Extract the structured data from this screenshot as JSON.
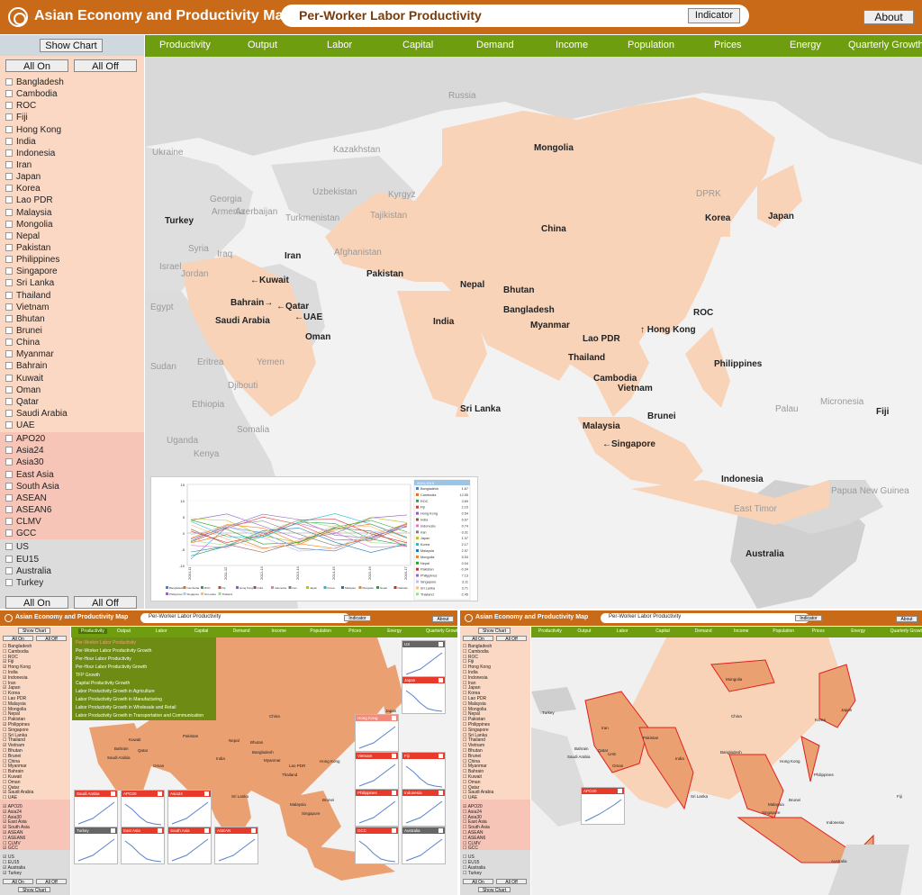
{
  "app": {
    "title": "Asian Economy and Productivity Map",
    "indicator_value": "Per-Worker Labor Productivity",
    "indicator_button": "Indicator",
    "about_button": "About"
  },
  "nav": [
    "Productivity",
    "Output",
    "Labor",
    "Capital",
    "Demand",
    "Income",
    "Population",
    "Prices",
    "Energy",
    "Quarterly Growth"
  ],
  "sidebar": {
    "show_chart": "Show Chart",
    "all_on": "All On",
    "all_off": "All Off",
    "economies": [
      "Bangladesh",
      "Cambodia",
      "ROC",
      "Fiji",
      "Hong Kong",
      "India",
      "Indonesia",
      "Iran",
      "Japan",
      "Korea",
      "Lao PDR",
      "Malaysia",
      "Mongolia",
      "Nepal",
      "Pakistan",
      "Philippines",
      "Singapore",
      "Sri Lanka",
      "Thailand",
      "Vietnam",
      "Bhutan",
      "Brunei",
      "China",
      "Myanmar",
      "Bahrain",
      "Kuwait",
      "Oman",
      "Qatar",
      "Saudi Arabia",
      "UAE"
    ],
    "groups": [
      "APO20",
      "Asia24",
      "Asia30",
      "East Asia",
      "South Asia",
      "ASEAN",
      "ASEAN6",
      "CLMV",
      "GCC"
    ],
    "others": [
      "US",
      "EU15",
      "Australia",
      "Turkey"
    ]
  },
  "map_labels": {
    "highlighted": [
      "Mongolia",
      "China",
      "Korea",
      "Japan",
      "Iran",
      "Pakistan",
      "Nepal",
      "Bhutan",
      "India",
      "Bangladesh",
      "Myanmar",
      "Lao PDR",
      "Thailand",
      "Cambodia",
      "Vietnam",
      "Hong Kong",
      "ROC",
      "Philippines",
      "Malaysia",
      "Singapore",
      "Brunei",
      "Indonesia",
      "Sri Lanka",
      "Kuwait",
      "Bahrain",
      "Qatar",
      "UAE",
      "Saudi Arabia",
      "Oman",
      "Fiji",
      "Australia",
      "Turkey"
    ],
    "grey": [
      "Russia",
      "Ukraine",
      "Kazakhstan",
      "Uzbekistan",
      "Kyrgyz",
      "Georgia",
      "Armenia",
      "Azerbaijan",
      "Turkmenistan",
      "Tajikistan",
      "DPRK",
      "Syria",
      "Iraq",
      "Israel",
      "Jordan",
      "Afghanistan",
      "Egypt",
      "Sudan",
      "Eritrea",
      "Yemen",
      "Djibouti",
      "Ethiopia",
      "Somalia",
      "Uganda",
      "Kenya",
      "Palau",
      "Micronesia",
      "Papua New Guinea",
      "East Timor"
    ]
  },
  "inset_chart": {
    "legend_title": "2010-2016",
    "legend": [
      {
        "name": "Bangladesh",
        "value": "1.67"
      },
      {
        "name": "Cambodia",
        "value": "12.55"
      },
      {
        "name": "ROC",
        "value": "3.69"
      },
      {
        "name": "Fiji",
        "value": "2.15"
      },
      {
        "name": "Hong Kong",
        "value": "0.54"
      },
      {
        "name": "India",
        "value": "6.67"
      },
      {
        "name": "Indonesia",
        "value": "0.74"
      },
      {
        "name": "Iran",
        "value": "-3.31"
      },
      {
        "name": "Japan",
        "value": "1.37"
      },
      {
        "name": "Korea",
        "value": "2.17"
      },
      {
        "name": "Malaysia",
        "value": "2.97"
      },
      {
        "name": "Mongolia",
        "value": "5.53"
      },
      {
        "name": "Nepal",
        "value": "0.04"
      },
      {
        "name": "Pakistan",
        "value": "-0.34"
      },
      {
        "name": "Philippines",
        "value": "7.13"
      },
      {
        "name": "Singapore",
        "value": "3.11"
      },
      {
        "name": "Sri Lanka",
        "value": "3.71"
      },
      {
        "name": "Thailand",
        "value": "-2.45"
      }
    ],
    "xticks": [
      "2010-11",
      "2011-12",
      "2012-13",
      "2013-14",
      "2014-15",
      "2015-16",
      "2016-17"
    ],
    "yticks": [
      "15",
      "10",
      "5",
      "0",
      "-5",
      "-10"
    ]
  },
  "mini_left": {
    "menu": [
      "Per-Worker Labor Productivity",
      "Per-Worker Labor Productivity Growth",
      "Per-Hour Labor Productivity",
      "Per-Hour Labor Productivity Growth",
      "TFP Growth",
      "Capital Productivity Growth",
      "Labor Productivity Growth in Agriculture",
      "Labor Productivity Growth in Manufacturing",
      "Labor Productivity Growth in Wholesale and Retail",
      "Labor Productivity Growth in Transportation and Communication"
    ],
    "panels": [
      "US",
      "Japan",
      "Hong Kong",
      "Vietnam",
      "Fiji",
      "Philippines",
      "Indonesia",
      "GCC",
      "Australia",
      "Saudi Arabia",
      "APO20",
      "Asia24",
      "Turkey",
      "East Asia",
      "South Asia",
      "ASEAN"
    ]
  },
  "mini_right": {
    "panel": "APO20"
  },
  "colors": {
    "topbar": "#c96a18",
    "nav": "#6e9e10",
    "sidebar": "#fad8c4",
    "highlight": "#f8d3b8",
    "mini_highlight": "#eaa070",
    "selected_border": "#e02020"
  }
}
